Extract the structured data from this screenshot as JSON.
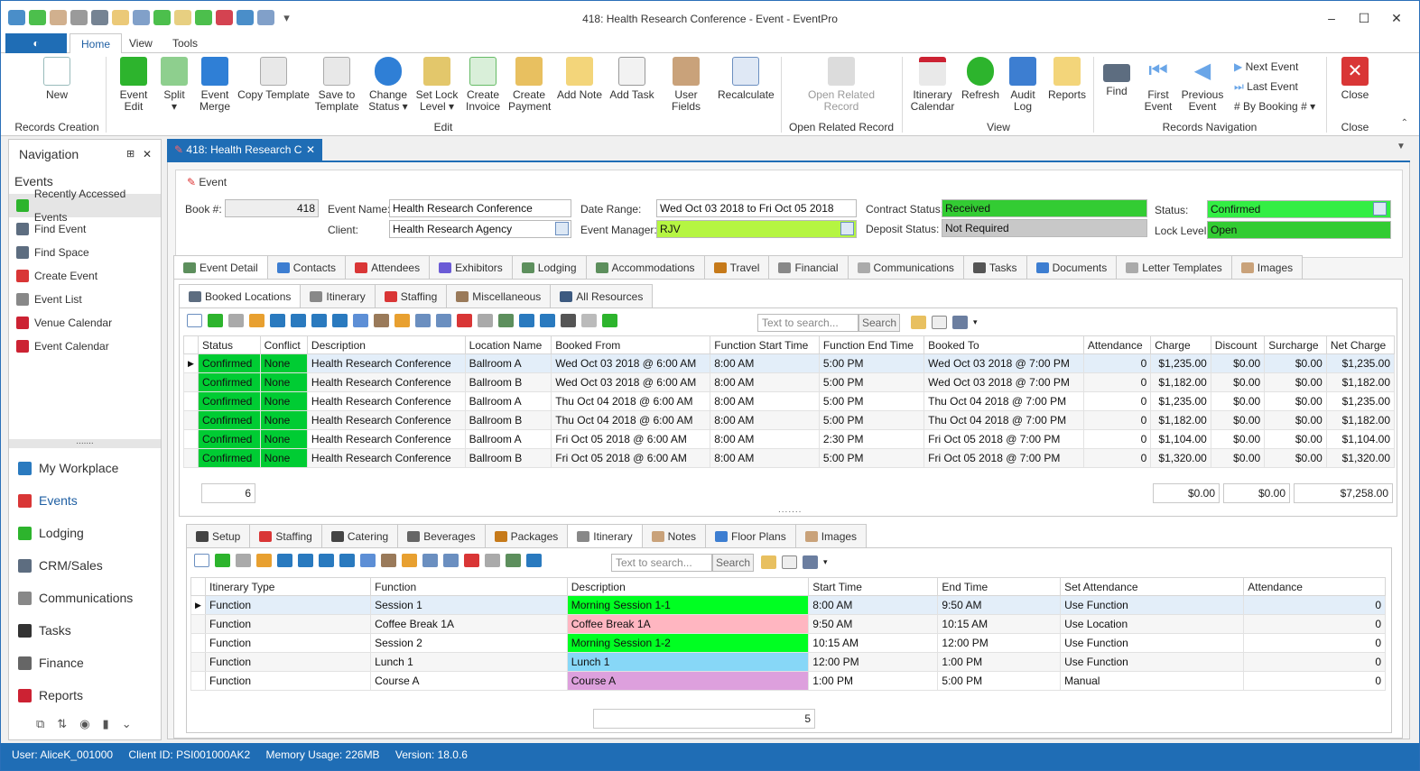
{
  "window": {
    "title": "418: Health Research Conference - Event - EventPro",
    "controls": [
      "–",
      "☐",
      "✕"
    ]
  },
  "quick_access": [
    "refresh-icon",
    "refresh-green-icon",
    "user-icon",
    "checklist-icon",
    "binoculars-icon",
    "document-icon",
    "grid-icon",
    "export-icon",
    "folder-icon",
    "settings-icon",
    "calendar-icon",
    "info-icon",
    "tools-icon",
    "dropdown-icon"
  ],
  "ribbon_tabs": [
    "Home",
    "View",
    "Tools"
  ],
  "ribbon": {
    "new": "New",
    "records_creation": "Records Creation",
    "event_edit": [
      "Event",
      "Edit"
    ],
    "split": "Split",
    "event_merge": [
      "Event",
      "Merge"
    ],
    "copy_template": "Copy Template",
    "save_to_template": [
      "Save to",
      "Template"
    ],
    "change_status": [
      "Change",
      "Status"
    ],
    "set_lock_level": [
      "Set Lock",
      "Level"
    ],
    "create_invoice": [
      "Create",
      "Invoice"
    ],
    "create_payment": [
      "Create",
      "Payment"
    ],
    "add_note": "Add Note",
    "add_task": "Add Task",
    "user_fields": "User Fields",
    "recalculate": "Recalculate",
    "edit_group": "Edit",
    "open_related_record": [
      "Open Related",
      "Record"
    ],
    "open_related_group": "Open Related Record",
    "itinerary_calendar": [
      "Itinerary",
      "Calendar"
    ],
    "refresh": "Refresh",
    "audit_log": [
      "Audit",
      "Log"
    ],
    "reports": "Reports",
    "view_group": "View",
    "find": "Find",
    "first_event": [
      "First",
      "Event"
    ],
    "previous_event": [
      "Previous",
      "Event"
    ],
    "next_event": "Next Event",
    "last_event": "Last Event",
    "by_booking": "By Booking #",
    "records_navigation": "Records Navigation",
    "close": "Close",
    "close_group": "Close"
  },
  "navigation": {
    "title": "Navigation",
    "section": "Events",
    "items": [
      "Recently Accessed Events",
      "Find Event",
      "Find Space",
      "Create Event",
      "Event List",
      "Venue Calendar",
      "Event Calendar"
    ],
    "modules": [
      "My Workplace",
      "Events",
      "Lodging",
      "CRM/Sales",
      "Communications",
      "Tasks",
      "Finance",
      "Reports"
    ],
    "splitter": "......."
  },
  "doc_tab": "418: Health Research C",
  "event": {
    "section": "Event",
    "book_label": "Book #:",
    "book_value": "418",
    "name_label": "Event Name:",
    "name_value": "Health Research Conference",
    "client_label": "Client:",
    "client_value": "Health Research Agency",
    "date_label": "Date Range:",
    "date_value": "Wed Oct 03 2018 to Fri Oct 05 2018",
    "manager_label": "Event Manager:",
    "manager_value": "RJV",
    "contract_label": "Contract Status:",
    "contract_value": "Received",
    "deposit_label": "Deposit Status:",
    "deposit_value": "Not Required",
    "status_label": "Status:",
    "status_value": "Confirmed",
    "lock_label": "Lock Level:",
    "lock_value": "Open"
  },
  "main_tabs": [
    "Event Detail",
    "Contacts",
    "Attendees",
    "Exhibitors",
    "Lodging",
    "Accommodations",
    "Travel",
    "Financial",
    "Communications",
    "Tasks",
    "Documents",
    "Letter Templates",
    "Images"
  ],
  "sub_tabs": [
    "Booked Locations",
    "Itinerary",
    "Staffing",
    "Miscellaneous",
    "All Resources"
  ],
  "search": {
    "placeholder": "Text to search...",
    "button": "Search"
  },
  "booked": {
    "columns": [
      "Status",
      "Conflict",
      "Description",
      "Location Name",
      "Booked From",
      "Function Start Time",
      "Function End Time",
      "Booked To",
      "Attendance",
      "Charge",
      "Discount",
      "Surcharge",
      "Net Charge"
    ],
    "rows": [
      [
        "Confirmed",
        "None",
        "Health Research Conference",
        "Ballroom A",
        "Wed Oct 03 2018 @ 6:00 AM",
        "8:00 AM",
        "5:00 PM",
        "Wed Oct 03 2018 @ 7:00 PM",
        "0",
        "$1,235.00",
        "$0.00",
        "$0.00",
        "$1,235.00"
      ],
      [
        "Confirmed",
        "None",
        "Health Research Conference",
        "Ballroom B",
        "Wed Oct 03 2018 @ 6:00 AM",
        "8:00 AM",
        "5:00 PM",
        "Wed Oct 03 2018 @ 7:00 PM",
        "0",
        "$1,182.00",
        "$0.00",
        "$0.00",
        "$1,182.00"
      ],
      [
        "Confirmed",
        "None",
        "Health Research Conference",
        "Ballroom A",
        "Thu Oct 04 2018 @ 6:00 AM",
        "8:00 AM",
        "5:00 PM",
        "Thu Oct 04 2018 @ 7:00 PM",
        "0",
        "$1,235.00",
        "$0.00",
        "$0.00",
        "$1,235.00"
      ],
      [
        "Confirmed",
        "None",
        "Health Research Conference",
        "Ballroom B",
        "Thu Oct 04 2018 @ 6:00 AM",
        "8:00 AM",
        "5:00 PM",
        "Thu Oct 04 2018 @ 7:00 PM",
        "0",
        "$1,182.00",
        "$0.00",
        "$0.00",
        "$1,182.00"
      ],
      [
        "Confirmed",
        "None",
        "Health Research Conference",
        "Ballroom A",
        "Fri Oct 05 2018 @ 6:00 AM",
        "8:00 AM",
        "2:30 PM",
        "Fri Oct 05 2018 @ 7:00 PM",
        "0",
        "$1,104.00",
        "$0.00",
        "$0.00",
        "$1,104.00"
      ],
      [
        "Confirmed",
        "None",
        "Health Research Conference",
        "Ballroom B",
        "Fri Oct 05 2018 @ 6:00 AM",
        "8:00 AM",
        "5:00 PM",
        "Fri Oct 05 2018 @ 7:00 PM",
        "0",
        "$1,320.00",
        "$0.00",
        "$0.00",
        "$1,320.00"
      ]
    ],
    "footer_count": "6",
    "footer_discount": "$0.00",
    "footer_surcharge": "$0.00",
    "footer_net": "$7,258.00"
  },
  "bottom_tabs": [
    "Setup",
    "Staffing",
    "Catering",
    "Beverages",
    "Packages",
    "Itinerary",
    "Notes",
    "Floor Plans",
    "Images"
  ],
  "itinerary": {
    "columns": [
      "Itinerary Type",
      "Function",
      "Description",
      "Start Time",
      "End Time",
      "Set Attendance",
      "Attendance"
    ],
    "rows": [
      {
        "cells": [
          "Function",
          "Session 1",
          "Morning Session 1-1",
          "8:00 AM",
          "9:50 AM",
          "Use Function",
          "0"
        ],
        "color": "#00ff22"
      },
      {
        "cells": [
          "Function",
          "Coffee Break 1A",
          "Coffee Break 1A",
          "9:50 AM",
          "10:15 AM",
          "Use Location",
          "0"
        ],
        "color": "#ffb6c1"
      },
      {
        "cells": [
          "Function",
          "Session 2",
          "Morning Session 1-2",
          "10:15 AM",
          "12:00 PM",
          "Use Function",
          "0"
        ],
        "color": "#00ff22"
      },
      {
        "cells": [
          "Function",
          "Lunch 1",
          "Lunch 1",
          "12:00 PM",
          "1:00 PM",
          "Use Function",
          "0"
        ],
        "color": "#87d7f7"
      },
      {
        "cells": [
          "Function",
          "Course A",
          "Course A",
          "1:00 PM",
          "5:00 PM",
          "Manual",
          "0"
        ],
        "color": "#dda0dd"
      }
    ],
    "footer_count": "5"
  },
  "status_bar": {
    "user": "User: AliceK_001000",
    "client": "Client ID: PSI001000AK2",
    "memory": "Memory Usage: 226MB",
    "version": "Version: 18.0.6"
  }
}
